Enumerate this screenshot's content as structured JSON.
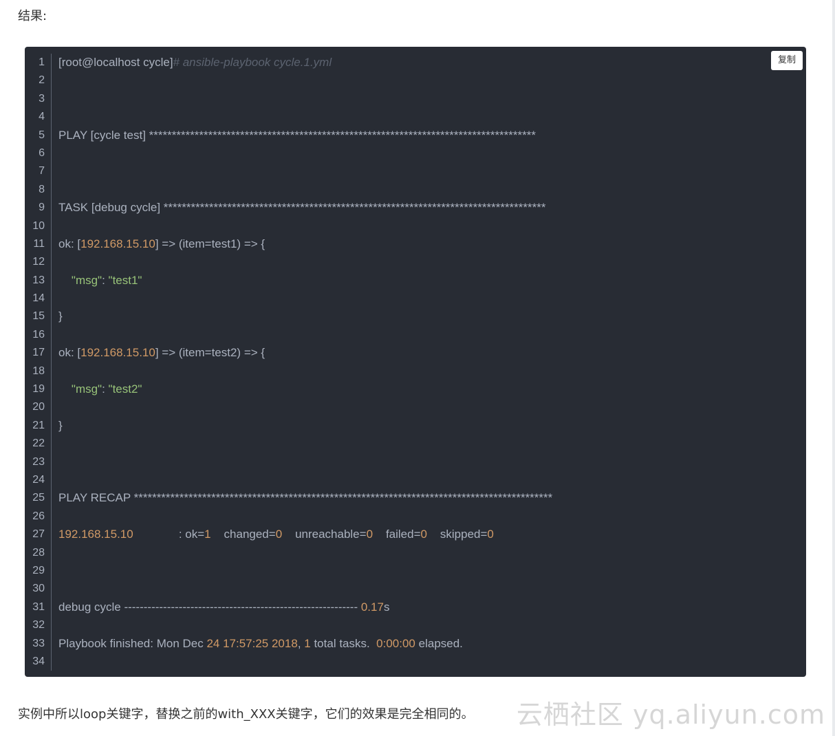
{
  "intro_text": "结果:",
  "copy_label": "复制",
  "code_lines": [
    [
      {
        "t": "[root@localhost cycle]"
      },
      {
        "t": "# ansible-playbook cycle.1.yml",
        "c": "cmt"
      }
    ],
    [],
    [],
    [],
    [
      {
        "t": "PLAY [cycle test] *************************************************************************************"
      }
    ],
    [],
    [],
    [],
    [
      {
        "t": "TASK [debug cycle] ************************************************************************************"
      }
    ],
    [],
    [
      {
        "t": "ok: ["
      },
      {
        "t": "192.168.15.10",
        "c": "num"
      },
      {
        "t": "] => (item=test1) => {"
      }
    ],
    [],
    [
      {
        "t": "    "
      },
      {
        "t": "\"msg\"",
        "c": "str"
      },
      {
        "t": ": "
      },
      {
        "t": "\"test1\"",
        "c": "str"
      }
    ],
    [],
    [
      {
        "t": "}"
      }
    ],
    [],
    [
      {
        "t": "ok: ["
      },
      {
        "t": "192.168.15.10",
        "c": "num"
      },
      {
        "t": "] => (item=test2) => {"
      }
    ],
    [],
    [
      {
        "t": "    "
      },
      {
        "t": "\"msg\"",
        "c": "str"
      },
      {
        "t": ": "
      },
      {
        "t": "\"test2\"",
        "c": "str"
      }
    ],
    [],
    [
      {
        "t": "}"
      }
    ],
    [],
    [],
    [],
    [
      {
        "t": "PLAY RECAP ********************************************************************************************"
      }
    ],
    [],
    [
      {
        "t": "192.168.15.10",
        "c": "num"
      },
      {
        "t": "              : ok="
      },
      {
        "t": "1",
        "c": "num"
      },
      {
        "t": "    changed="
      },
      {
        "t": "0",
        "c": "num"
      },
      {
        "t": "    unreachable="
      },
      {
        "t": "0",
        "c": "num"
      },
      {
        "t": "    failed="
      },
      {
        "t": "0",
        "c": "num"
      },
      {
        "t": "    skipped="
      },
      {
        "t": "0",
        "c": "num"
      }
    ],
    [],
    [],
    [],
    [
      {
        "t": "debug cycle ------------------------------------------------------------ "
      },
      {
        "t": "0.17",
        "c": "num"
      },
      {
        "t": "s"
      }
    ],
    [],
    [
      {
        "t": "Playbook finished: Mon Dec "
      },
      {
        "t": "24 17:57:25 2018",
        "c": "num"
      },
      {
        "t": ", "
      },
      {
        "t": "1",
        "c": "num"
      },
      {
        "t": " total tasks.  "
      },
      {
        "t": "0:00:00",
        "c": "num"
      },
      {
        "t": " elapsed."
      }
    ],
    []
  ],
  "outro_text": "实例中所以loop关键字，替换之前的with_XXX关键字，它们的效果是完全相同的。",
  "watermark_text": "云栖社区 yq.aliyun.com",
  "colors": {
    "code_bg": "#282c34",
    "code_text": "#abb2bf",
    "number": "#d19a66",
    "string": "#98c379",
    "comment": "#5c6370"
  }
}
